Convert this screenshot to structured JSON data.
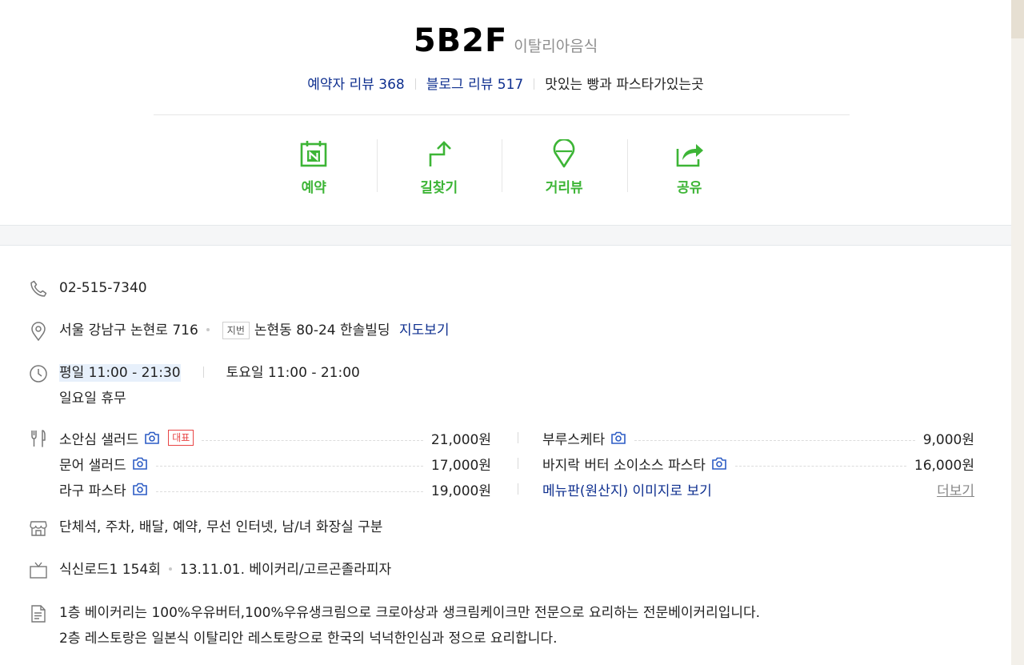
{
  "place": {
    "name": "5B2F",
    "category": "이탈리아음식",
    "reviews_visitor": "예약자 리뷰 368",
    "reviews_blog": "블로그 리뷰 517",
    "description": "맛있는 빵과 파스타가있는곳"
  },
  "actions": [
    {
      "label": "예약",
      "icon": "calendar-n-icon"
    },
    {
      "label": "길찾기",
      "icon": "directions-arrow-icon"
    },
    {
      "label": "거리뷰",
      "icon": "street-view-pin-icon"
    },
    {
      "label": "공유",
      "icon": "share-icon"
    }
  ],
  "info": {
    "phone": "02-515-7340",
    "address": "서울 강남구 논현로 716",
    "jibun_tag": "지번",
    "jibun": "논현동 80-24 한솔빌딩",
    "map_link": "지도보기",
    "hours_weekday": "평일 11:00 - 21:30",
    "hours_saturday": "토요일 11:00 - 21:00",
    "hours_sunday": "일요일 휴무",
    "facilities": "단체석, 주차, 배달, 예약, 무선 인터넷, 남/녀 화장실 구분",
    "tv_show": "식신로드1 154회",
    "tv_detail": "13.11.01. 베이커리/고르곤졸라피자",
    "intro_line1": "1층 베이커리는 100%우유버터,100%우유생크림으로 크로아상과 생크림케이크만 전문으로 요리하는 전문베이커리입니다.",
    "intro_line2": "2층 레스토랑은 일본식 이탈리안 레스토랑으로 한국의 넉넉한인심과 정으로 요리합니다."
  },
  "menu": {
    "left": [
      {
        "name": "소안심 샐러드",
        "badge": "대표",
        "price": "21,000원"
      },
      {
        "name": "문어 샐러드",
        "price": "17,000원"
      },
      {
        "name": "라구 파스타",
        "price": "19,000원"
      }
    ],
    "right": [
      {
        "name": "부루스케타",
        "price": "9,000원"
      },
      {
        "name": "바지락 버터 소이소스 파스타",
        "price": "16,000원"
      }
    ],
    "menu_board_link": "메뉴판(원산지) 이미지로 보기",
    "more_link": "더보기"
  },
  "colors": {
    "brand_green": "#3db536",
    "link_blue": "#0e2f8f",
    "badge_red": "#e84545"
  }
}
